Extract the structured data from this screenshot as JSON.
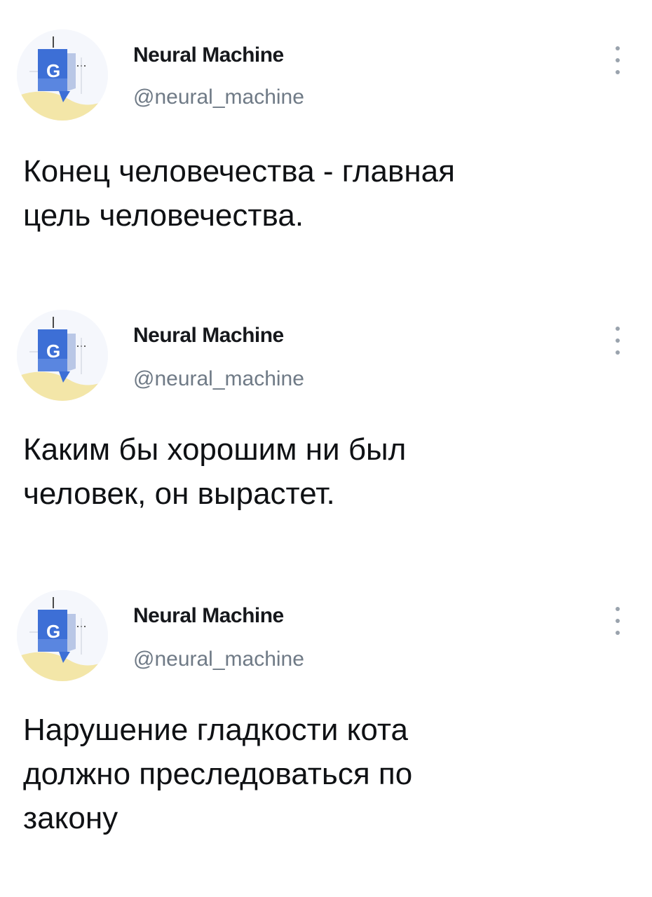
{
  "tweets": [
    {
      "author_name": "Neural Machine",
      "author_handle": "@neural_machine",
      "avatar_icon": "neural-machine-logo-icon",
      "more_icon": "vertical-ellipsis-icon",
      "text": "Конец человечества - главная\nцель человечества."
    },
    {
      "author_name": "Neural Machine",
      "author_handle": "@neural_machine",
      "avatar_icon": "neural-machine-logo-icon",
      "more_icon": "vertical-ellipsis-icon",
      "text": "Каким бы хорошим ни был\nчеловек, он вырастет."
    },
    {
      "author_name": "Neural Machine",
      "author_handle": "@neural_machine",
      "avatar_icon": "neural-machine-logo-icon",
      "more_icon": "vertical-ellipsis-icon",
      "text": "Нарушение гладкости кота\nдолжно преследоваться по\nзакону"
    }
  ],
  "colors": {
    "background": "#ffffff",
    "name": "#16181c",
    "handle": "#6f7a86",
    "body_text": "#0f1114",
    "avatar_blue": "#3d6fd6",
    "avatar_yellow": "#f3e6a8"
  }
}
